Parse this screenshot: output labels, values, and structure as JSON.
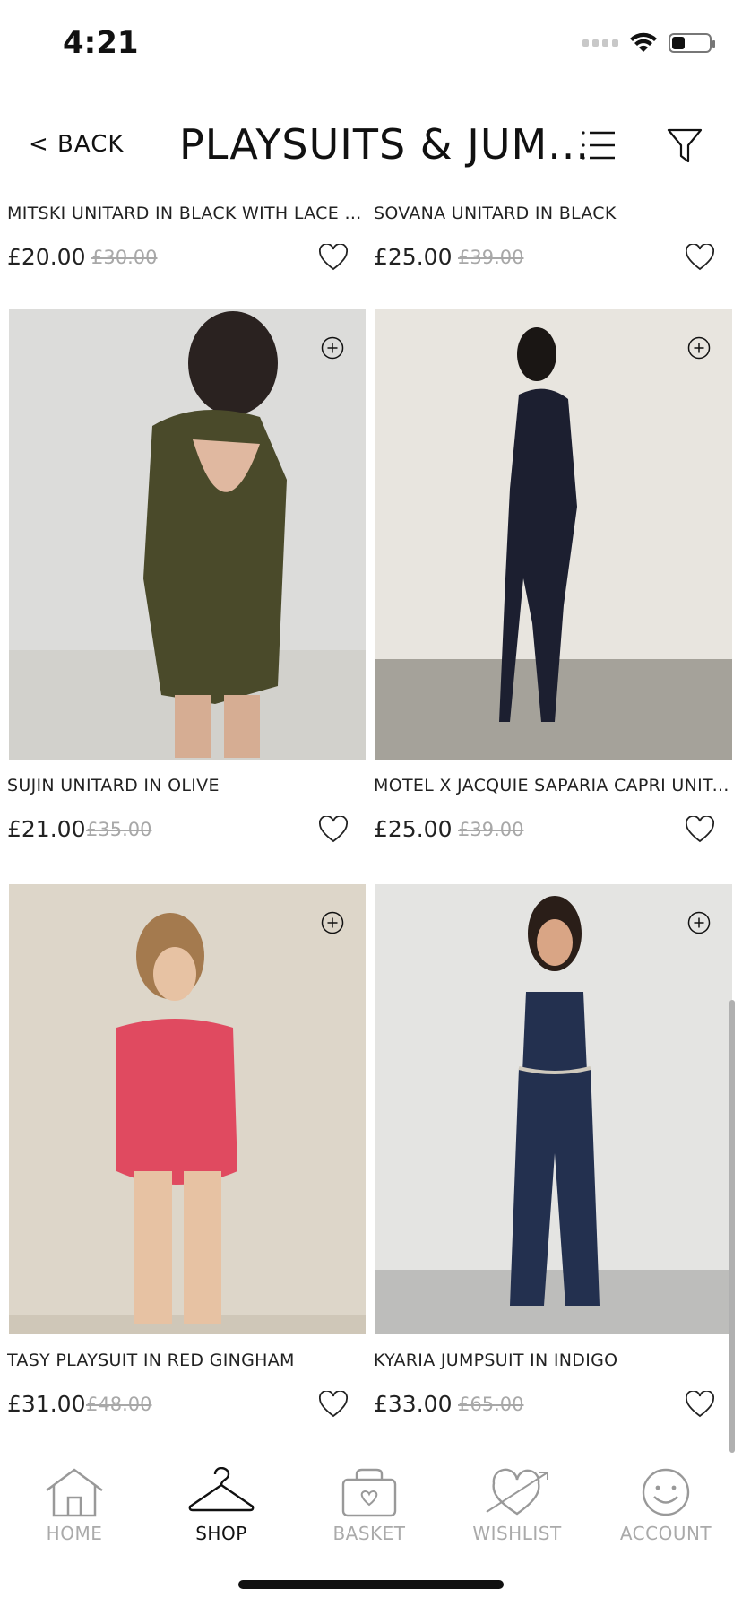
{
  "status": {
    "time": "4:21",
    "battery_level": 0.35
  },
  "nav": {
    "back_label": "< BACK",
    "title": "PLAYSUITS & JUM..."
  },
  "products_top": [
    {
      "name": "MITSKI UNITARD IN BLACK WITH LACE TR...",
      "price": "£20.00",
      "was": "£30.00"
    },
    {
      "name": "SOVANA UNITARD IN BLACK",
      "price": "£25.00",
      "was": "£39.00"
    }
  ],
  "products": [
    {
      "name": "SUJIN UNITARD IN OLIVE",
      "price": "£21.00",
      "was": "£35.00",
      "color": "#4a4a2a"
    },
    {
      "name": "MOTEL X JACQUIE SAPARIA CAPRI UNITA...",
      "price": "£25.00",
      "was": "£39.00",
      "color": "#1c1f30"
    },
    {
      "name": "TASY PLAYSUIT IN RED GINGHAM",
      "price": "£31.00",
      "was": "£48.00",
      "color": "#e04a60"
    },
    {
      "name": "KYARIA JUMPSUIT IN INDIGO",
      "price": "£33.00",
      "was": "£65.00",
      "color": "#23304f"
    }
  ],
  "tabs": [
    {
      "label": "HOME",
      "icon": "home-icon"
    },
    {
      "label": "SHOP",
      "icon": "hanger-icon",
      "active": true
    },
    {
      "label": "BASKET",
      "icon": "basket-icon"
    },
    {
      "label": "WISHLIST",
      "icon": "heart-arrow-icon"
    },
    {
      "label": "ACCOUNT",
      "icon": "smiley-icon"
    }
  ]
}
